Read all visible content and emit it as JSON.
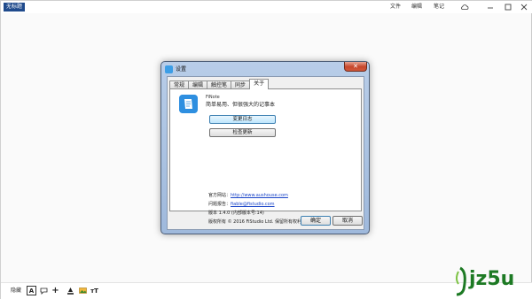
{
  "app": {
    "title": "无标题",
    "menu": {
      "file": "文件",
      "edit": "编辑",
      "note": "笔记"
    },
    "bottom_label": "隐藏",
    "bottom_tools": {
      "text": "A",
      "plus": "+",
      "format": "ᴛT"
    }
  },
  "dialog": {
    "title": "设置",
    "close": "✕",
    "tabs": [
      "常规",
      "编辑",
      "触控笔",
      "同步",
      "关于"
    ],
    "about": {
      "app_name": "FiNote",
      "slogan": "简单易用、但很强大的记事本",
      "changelog_button": "变更日志",
      "check_update_button": "检查更新",
      "site_label": "官方网站：",
      "site_url": "http://www.aushouse.com",
      "feedback_label": "问题报告：",
      "feedback_email": "fiable@fistudio.com",
      "version": "版本 1.4.0 (内部版本号:14)",
      "copyright": "版权所有 © 2016 FiStudio Ltd. 保留所有权利"
    },
    "ok_button": "确定",
    "cancel_button": "取消"
  },
  "watermark": {
    "text": "jz5u"
  },
  "colors": {
    "title_bg": "#1f4a8c",
    "link": "#1a45c8",
    "logo": "#2e8fe0",
    "close_btn": "#c5452a",
    "watermark": "#1d7a24"
  }
}
